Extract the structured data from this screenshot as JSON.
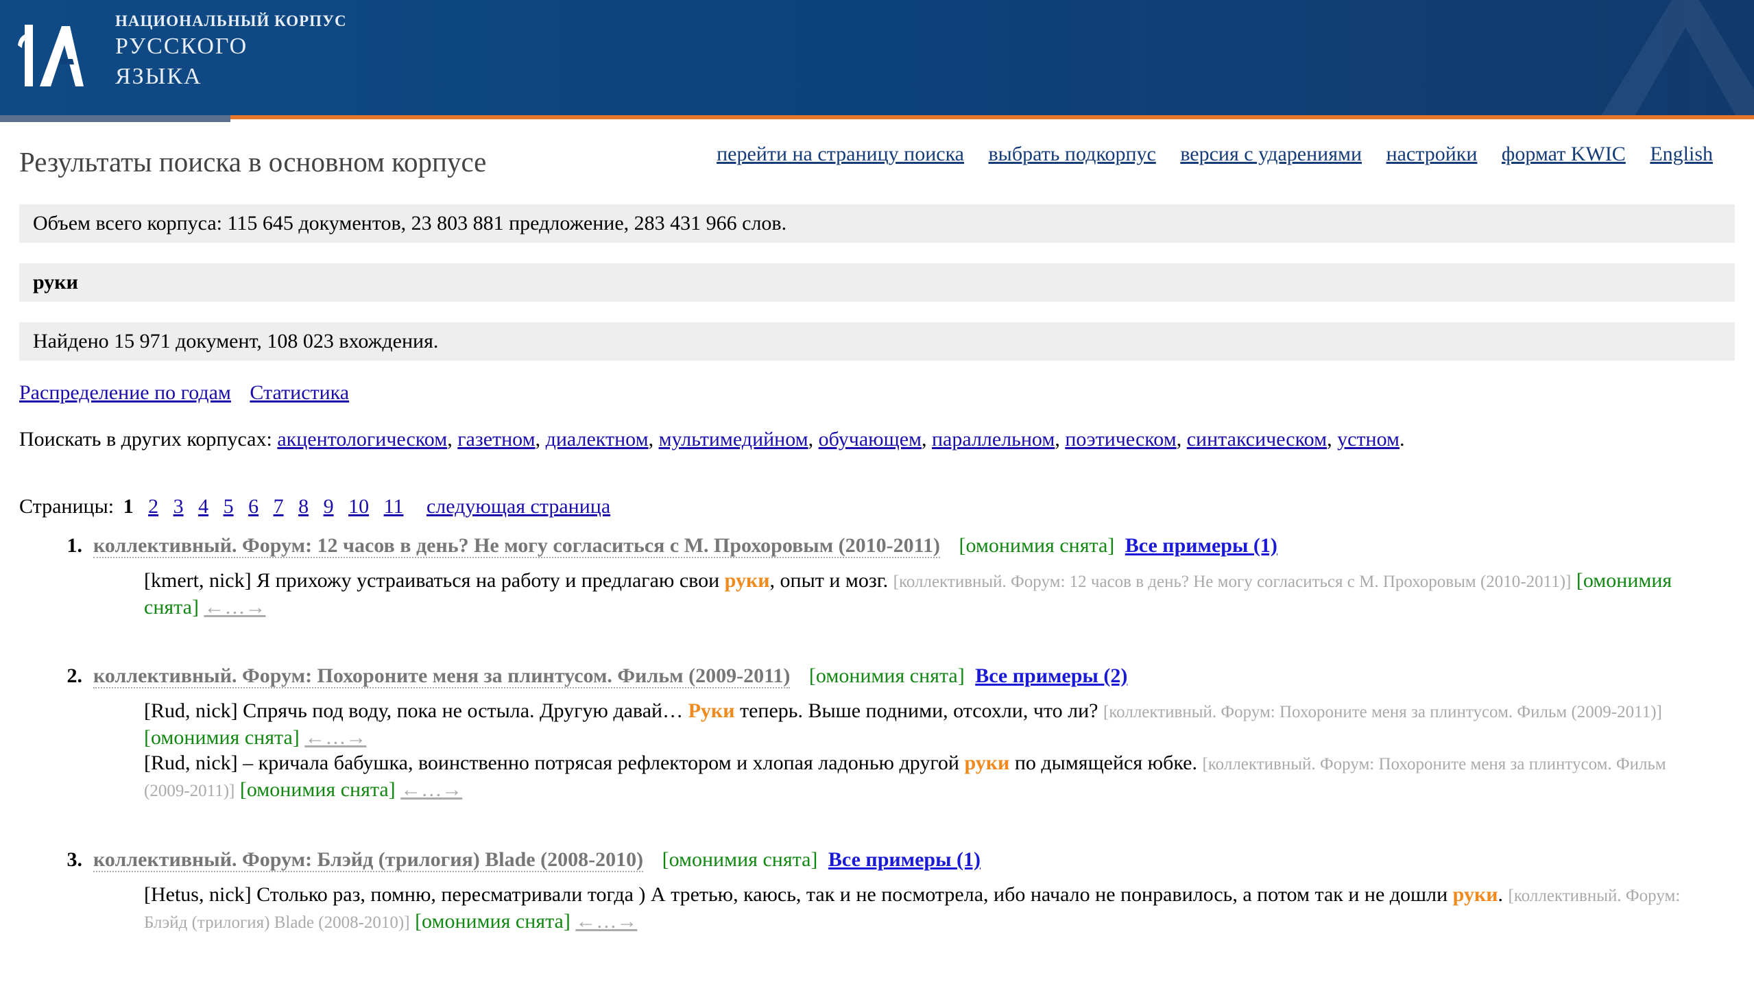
{
  "header": {
    "logo_line1": "НАЦИОНАЛЬНЫЙ КОРПУС",
    "logo_line2": "РУССКОГО",
    "logo_line3": "ЯЗЫКА",
    "colors": {
      "brand_blue": "#0e4179",
      "accent_orange": "#e8782a"
    }
  },
  "page_title": "Результаты поиска в основном корпусе",
  "top_nav": [
    "перейти на страницу поиска",
    "выбрать подкорпус",
    "версия с ударениями",
    "настройки",
    "формат KWIC",
    "English"
  ],
  "corpus_volume": "Объем всего корпуса: 115 645 документов, 23 803 881 предложение, 283 431 966 слов.",
  "query": "руки",
  "found": "Найдено 15 971 документ, 108 023 вхождения.",
  "stats_links": [
    "Распределение по годам",
    "Статистика"
  ],
  "other_corpora": {
    "label": "Поискать в других корпусах:",
    "links": [
      "акцентологическом",
      "газетном",
      "диалектном",
      "мультимедийном",
      "обучающем",
      "параллельном",
      "поэтическом",
      "синтаксическом",
      "устном"
    ]
  },
  "pager": {
    "label": "Страницы:",
    "current": "1",
    "pages": [
      "2",
      "3",
      "4",
      "5",
      "6",
      "7",
      "8",
      "9",
      "10",
      "11"
    ],
    "next": "следующая страница"
  },
  "results": [
    {
      "num": "1.",
      "title": "коллективный. Форум: 12 часов в день? Не могу согласиться с М. Прохоровым (2010-2011)",
      "homonymy": "[омонимия снята]",
      "all_examples": "Все примеры (1)",
      "examples": [
        {
          "before": "[kmert, nick] Я прихожу устраиваться на работу и предлагаю свои ",
          "hit": "руки",
          "after": ", опыт и мозг. ",
          "source": "[коллективный. Форум: 12 часов в день? Не могу согласиться с М. Прохоровым (2010-2011)]",
          "homonymy": "[омонимия снята]",
          "arrows": "←…→"
        }
      ]
    },
    {
      "num": "2.",
      "title": "коллективный. Форум: Похороните меня за плинтусом. Фильм (2009-2011)",
      "homonymy": "[омонимия снята]",
      "all_examples": "Все примеры (2)",
      "examples": [
        {
          "before": "[Rud, nick] Спрячь под воду, пока не остыла. Другую давай… ",
          "hit": "Руки",
          "after": " теперь. Выше подними, отсохли, что ли? ",
          "source": "[коллективный. Форум: Похороните меня за плинтусом. Фильм (2009-2011)]",
          "homonymy": "[омонимия снята]",
          "arrows": "←…→"
        },
        {
          "before": "[Rud, nick] – кричала бабушка, воинственно потрясая рефлектором и хлопая ладонью другой ",
          "hit": "руки",
          "after": " по дымящейся юбке. ",
          "source": "[коллективный. Форум: Похороните меня за плинтусом. Фильм (2009-2011)]",
          "homonymy": "[омонимия снята]",
          "arrows": "←…→"
        }
      ]
    },
    {
      "num": "3.",
      "title": "коллективный. Форум: Блэйд (трилогия) Blade (2008-2010)",
      "homonymy": "[омонимия снята]",
      "all_examples": "Все примеры (1)",
      "examples": [
        {
          "before": "[Hetus, nick] Столько раз, помню, пересматривали тогда ) А третью, каюсь, так и не посмотрела, ибо начало не понравилось, а потом так и не дошли ",
          "hit": "руки",
          "after": ". ",
          "source": "[коллективный. Форум: Блэйд (трилогия) Blade (2008-2010)]",
          "homonymy": "[омонимия снята]",
          "arrows": "←…→"
        }
      ]
    }
  ]
}
